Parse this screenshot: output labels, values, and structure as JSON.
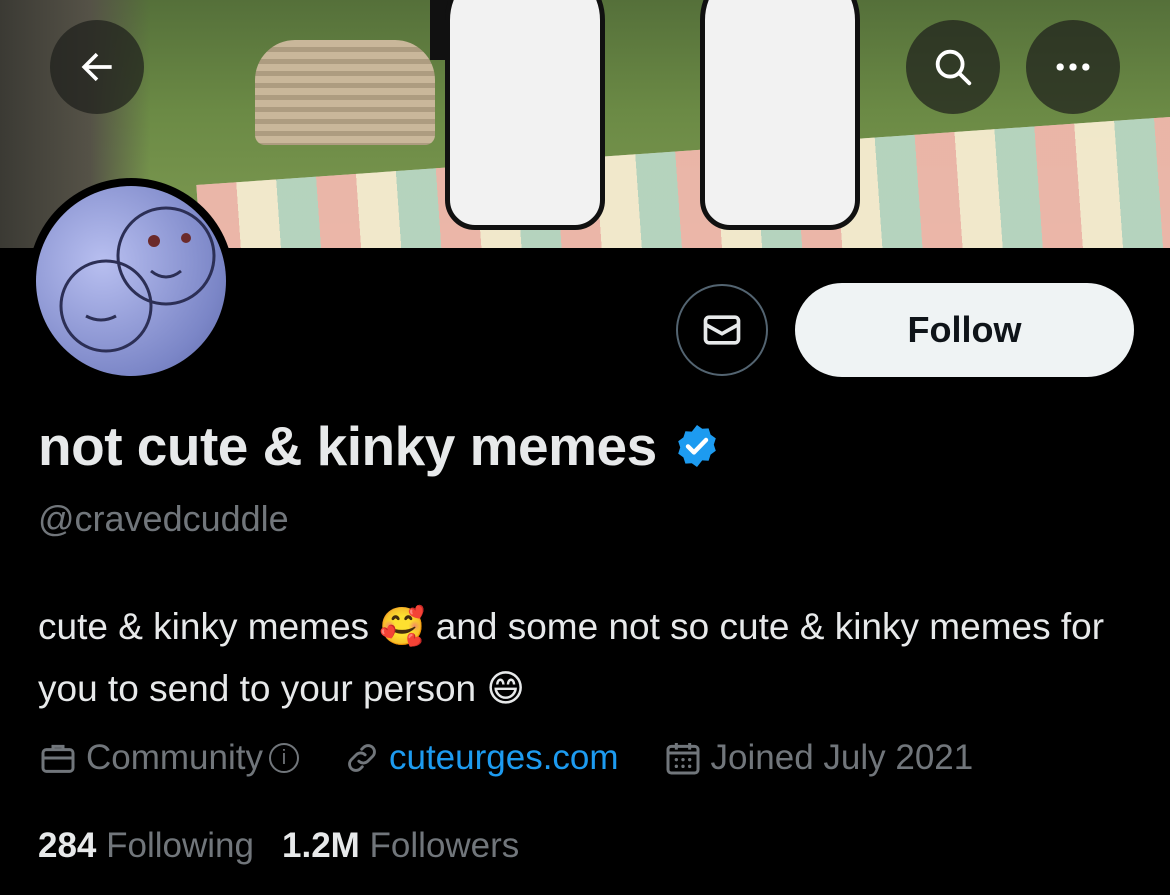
{
  "profile": {
    "display_name": "not cute & kinky memes",
    "handle": "@cravedcuddle",
    "bio_part1": "cute & kinky memes ",
    "bio_emoji1": "🥰",
    "bio_part2": " and some not so cute & kinky memes for you to send to your person ",
    "bio_emoji2": "😄",
    "category": "Community",
    "website": "cuteurges.com",
    "joined": "Joined July 2021"
  },
  "actions": {
    "follow_label": "Follow"
  },
  "stats": {
    "following_count": "284",
    "following_label": "Following",
    "followers_count": "1.2M",
    "followers_label": "Followers"
  },
  "colors": {
    "background": "#000000",
    "accent_link": "#1d9bf0",
    "muted_text": "#71767b",
    "follow_button_bg": "#eff3f4"
  },
  "icons": [
    "arrow-left-icon",
    "search-icon",
    "more-icon",
    "mail-icon",
    "verified-badge-icon",
    "briefcase-icon",
    "info-icon",
    "link-icon",
    "calendar-icon"
  ]
}
